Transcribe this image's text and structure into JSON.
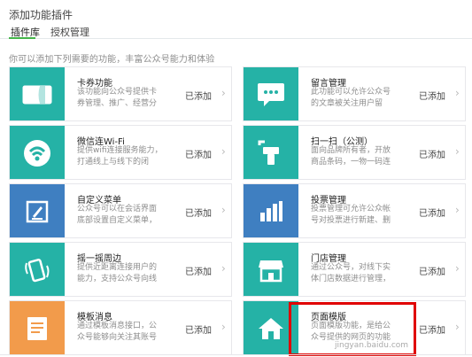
{
  "header": {
    "title": "添加功能插件"
  },
  "tabs": [
    {
      "label": "插件库",
      "active": true
    },
    {
      "label": "授权管理",
      "active": false
    }
  ],
  "intro": "你可以添加下列需要的功能，丰富公众号能力和体验",
  "colors": {
    "accent_green": "#44b549",
    "teal": "#25b2a6",
    "blue": "#3f7fc1",
    "orange": "#f29b4b",
    "highlight_red": "#e00000"
  },
  "plugins": [
    {
      "name": "卡券功能",
      "desc": "该功能向公众号提供卡券管理、推广、经营分析的整套解决方案。",
      "status": "已添加",
      "icon": "card-icon",
      "color": "#25b2a6"
    },
    {
      "name": "留言管理",
      "desc": "此功能可以允许公众号的文章被关注用户留言，加强彼此间的互动。",
      "status": "已添加",
      "icon": "comment-icon",
      "color": "#25b2a6"
    },
    {
      "name": "微信连Wi-Fi",
      "desc": "提供wifi连接服务能力，打通线上与线下的闭环，更好地提高商户的经营效率。",
      "status": "已添加",
      "icon": "wifi-icon",
      "color": "#25b2a6"
    },
    {
      "name": "扫一扫（公测）",
      "desc": "面向品牌所有者，开放商品条码，一物一码连接能力，用于信息展示、服务提供",
      "status": "已添加",
      "icon": "scan-icon",
      "color": "#25b2a6"
    },
    {
      "name": "自定义菜单",
      "desc": "公众号可以在会话界面底部设置自定义菜单，并可为其设置响应动作",
      "status": "已添加",
      "icon": "edit-icon",
      "color": "#3f7fc1"
    },
    {
      "name": "投票管理",
      "desc": "投票管理可允许公众帐号对投票进行新建、删除和查看的操作。",
      "status": "已添加",
      "icon": "bar-chart-icon",
      "color": "#3f7fc1"
    },
    {
      "name": "摇一摇周边",
      "desc": "提供近距离连接用户的能力，支持公众号向线下用户提供个性化信息、互动及服务",
      "status": "已添加",
      "icon": "shake-icon",
      "color": "#25b2a6"
    },
    {
      "name": "门店管理",
      "desc": "通过公众号，对线下实体门店数据进行管理，并在相关业务场景中运营和展示",
      "status": "已添加",
      "icon": "store-icon",
      "color": "#25b2a6"
    },
    {
      "name": "模板消息",
      "desc": "通过模板消息接口，公众号能够向关注其账号的用户发送预设模板的消息。",
      "status": "已添加",
      "icon": "document-icon",
      "color": "#f29b4b"
    },
    {
      "name": "页面模版",
      "desc": "页面模版功能，是给公众号提供的网页的功能插件。",
      "status": "已添加",
      "icon": "home-icon",
      "color": "#25b2a6"
    }
  ],
  "watermark": "jingyan.baidu.com"
}
